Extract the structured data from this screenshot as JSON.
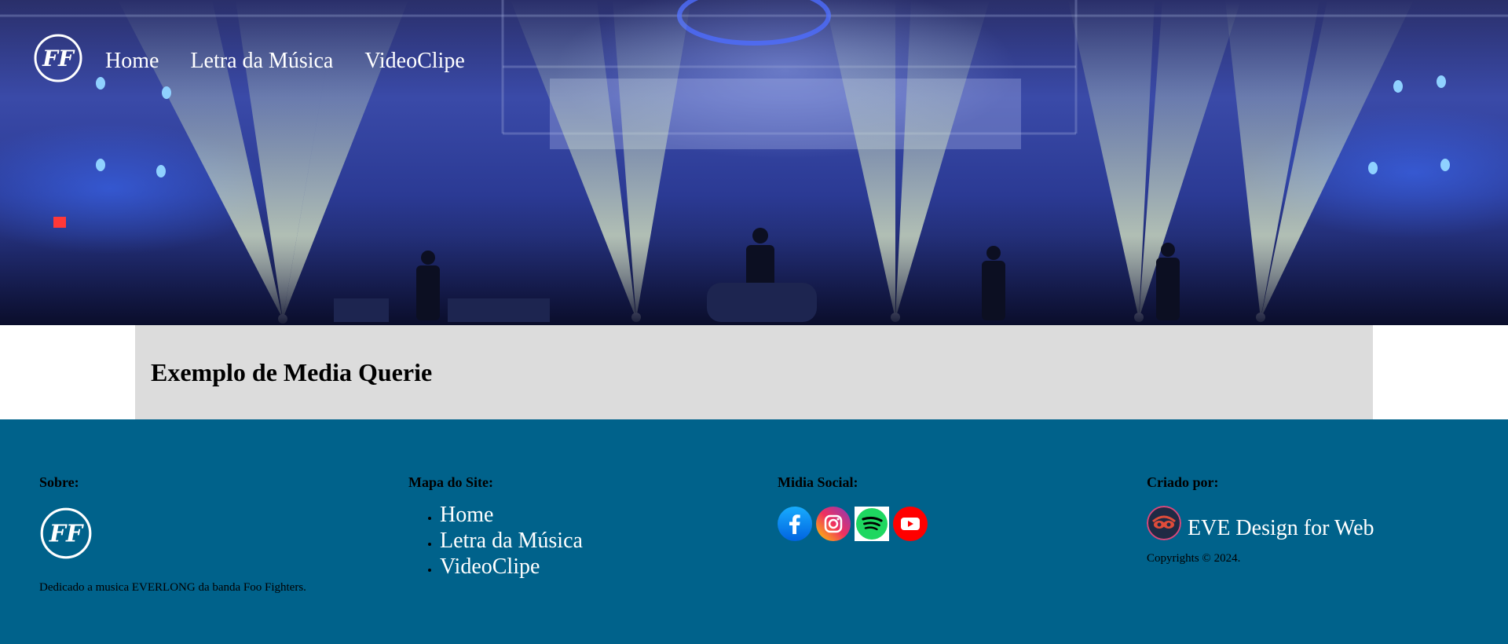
{
  "nav": {
    "items": [
      {
        "label": "Home"
      },
      {
        "label": "Letra da Música"
      },
      {
        "label": "VideoClipe"
      }
    ]
  },
  "logo": {
    "icon": "ff-logo-icon"
  },
  "main": {
    "title": "Exemplo de Media Querie"
  },
  "footer": {
    "about": {
      "heading": "Sobre:",
      "text": "Dedicado a musica EVERLONG da banda Foo Fighters."
    },
    "sitemap": {
      "heading": "Mapa do Site:",
      "items": [
        {
          "label": "Home"
        },
        {
          "label": "Letra da Música"
        },
        {
          "label": "VideoClipe"
        }
      ]
    },
    "social": {
      "heading": "Midia Social:",
      "icons": [
        "facebook-icon",
        "instagram-icon",
        "spotify-icon",
        "youtube-icon"
      ]
    },
    "credits": {
      "heading": "Criado por:",
      "name": "EVE Design for Web",
      "copyright": "Copyrights © 2024."
    }
  },
  "colors": {
    "footer_bg": "#00628b",
    "band_bg": "#dcdcdc",
    "link": "#ffffff"
  }
}
